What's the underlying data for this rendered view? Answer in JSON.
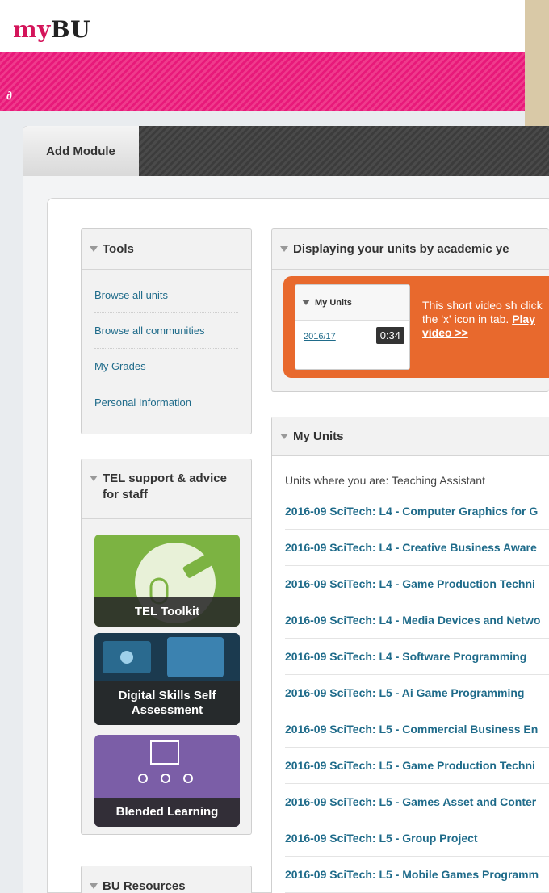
{
  "header": {
    "logo_my": "my",
    "logo_bu": "BU"
  },
  "tabs": {
    "add_module": "Add Module"
  },
  "tools": {
    "title": "Tools",
    "items": [
      "Browse all units",
      "Browse all communities",
      "My Grades",
      "Personal Information"
    ]
  },
  "tel": {
    "title_line1": "TEL support & advice",
    "title_line2": "for staff",
    "tiles": [
      "TEL Toolkit",
      "Digital Skills Self Assessment",
      "Blended Learning"
    ]
  },
  "bu_resources": {
    "title": "BU Resources"
  },
  "display": {
    "title": "Displaying your units by academic ye",
    "thumb_header": "My Units",
    "thumb_year": "2016/17",
    "thumb_duration": "0:34",
    "text": "This short video sh click the 'x' icon in tab.",
    "play": "Play video >>"
  },
  "my_units": {
    "title": "My Units",
    "note": "Units where you are: Teaching Assistant",
    "units": [
      "2016-09 SciTech: L4 - Computer Graphics for G",
      "2016-09 SciTech: L4 - Creative Business Aware",
      "2016-09 SciTech: L4 - Game Production Techni",
      "2016-09 SciTech: L4 - Media Devices and Netwo",
      "2016-09 SciTech: L4 - Software Programming",
      "2016-09 SciTech: L5 - Ai Game Programming",
      "2016-09 SciTech: L5 - Commercial Business En",
      "2016-09 SciTech: L5 - Game Production Techni",
      "2016-09 SciTech: L5 - Games Asset and Conter",
      "2016-09 SciTech: L5 - Group Project",
      "2016-09 SciTech: L5 - Mobile Games Programm"
    ]
  },
  "colors": {
    "brand_pink": "#e8197a",
    "link_blue": "#1f6b8a",
    "video_orange": "#e8692d"
  }
}
